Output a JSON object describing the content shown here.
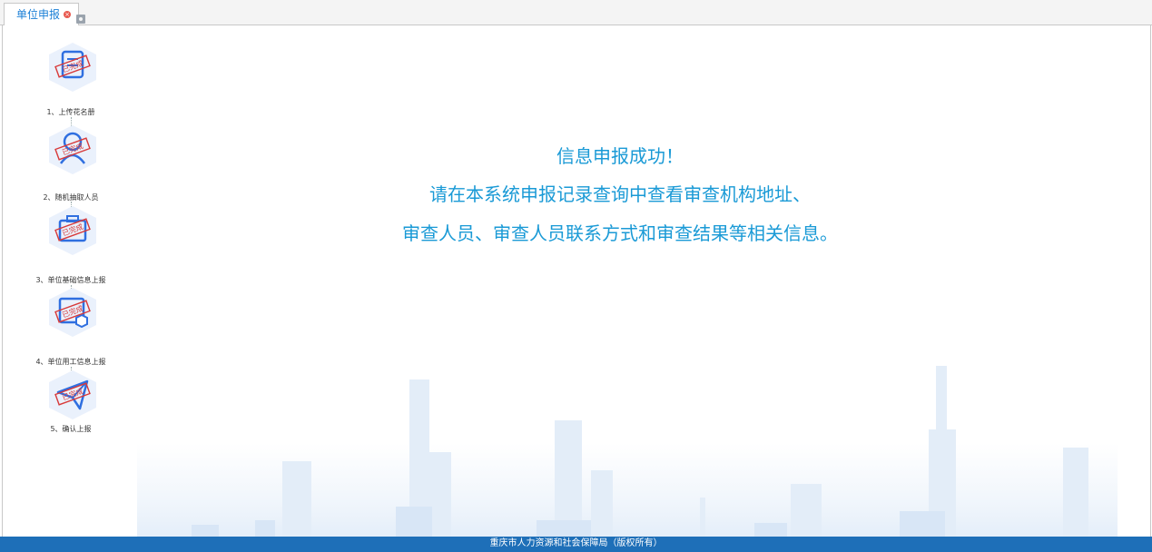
{
  "tab": {
    "label": "单位申报",
    "close_icon": "close-icon",
    "menu_icon": "gear-icon"
  },
  "steps": [
    {
      "label": "1、上传花名册",
      "icon": "roster-upload-icon",
      "stamp": "已完成"
    },
    {
      "label": "2、随机抽取人员",
      "icon": "person-select-icon",
      "stamp": "已完成"
    },
    {
      "label": "3、单位基础信息上报",
      "icon": "briefcase-icon",
      "stamp": "已完成"
    },
    {
      "label": "4、单位用工信息上报",
      "icon": "employment-info-icon",
      "stamp": "已完成"
    },
    {
      "label": "5、确认上报",
      "icon": "paper-plane-icon",
      "stamp": "已完成"
    }
  ],
  "message": {
    "line1": "信息申报成功！",
    "line2": "请在本系统申报记录查询中查看审查机构地址、",
    "line3": "审查人员、审查人员联系方式和审查结果等相关信息。"
  },
  "footer": {
    "text": "重庆市人力资源和社会保障局（版权所有）"
  },
  "colors": {
    "accent": "#1a9ad6",
    "footer_bg": "#1e6fb8",
    "stamp": "#d83a3a",
    "icon": "#2f6fe0"
  }
}
